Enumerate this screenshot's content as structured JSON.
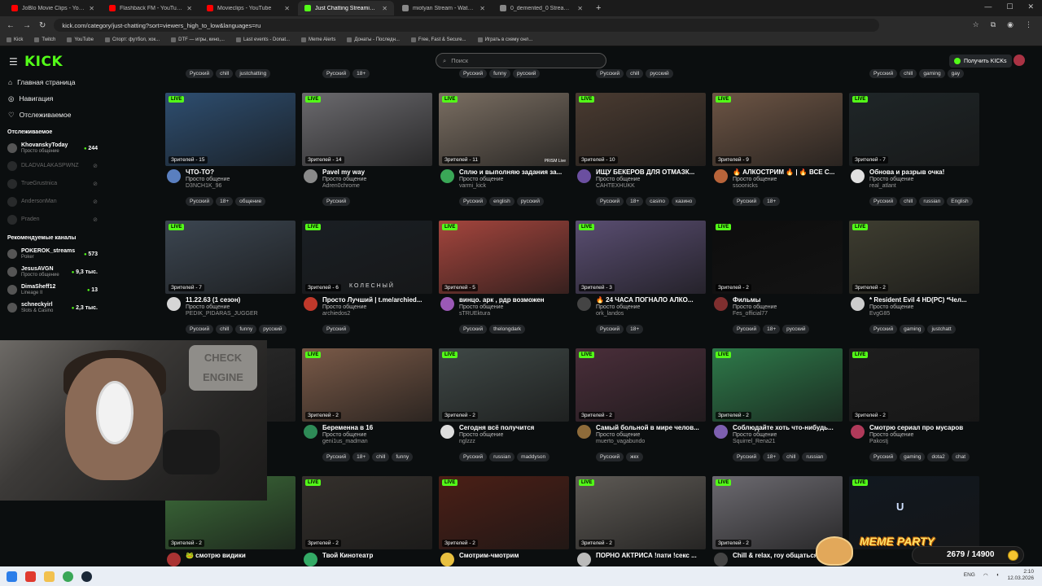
{
  "browser": {
    "tabs": [
      {
        "title": "JoBlo Movie Clips - YouTube",
        "color": "#ff0000",
        "active": false
      },
      {
        "title": "Flashback FM - YouTube",
        "color": "#ff0000",
        "active": false
      },
      {
        "title": "Movieclips - YouTube",
        "color": "#ff0000",
        "active": false
      },
      {
        "title": "Just Chatting Streaming - Live",
        "color": "#53fc18",
        "active": true
      },
      {
        "title": "miotyan Stream - Watch Live o",
        "color": "#888888",
        "active": false
      },
      {
        "title": "0_demented_0 Stream - Watch",
        "color": "#888888",
        "active": false
      }
    ],
    "url": "kick.com/category/just-chatting?sort=viewers_high_to_low&languages=ru",
    "bookmarks": [
      "Kick",
      "Twitch",
      "YouTube",
      "Спорт: футбол, хок...",
      "DTF — игры, кино,...",
      "Last events - Donat...",
      "Meme Alerts",
      "Донаты - Последн...",
      "Free, Fast & Secure...",
      "Играть в схему онл..."
    ]
  },
  "header": {
    "logo": "KICK",
    "search_placeholder": "Поиск",
    "get_kicks": "Получить KICKs"
  },
  "sidebar": {
    "nav": [
      {
        "label": "Главная страница",
        "icon": "home-icon"
      },
      {
        "label": "Навигация",
        "icon": "compass-icon"
      },
      {
        "label": "Отслеживаемое",
        "icon": "heart-icon"
      }
    ],
    "following_title": "Отслеживаемое",
    "following": [
      {
        "name": "KhovanskyToday",
        "category": "Просто общение",
        "count": "244",
        "online": true
      },
      {
        "name": "DLADVALAKASPWNZ",
        "category": "",
        "count": "",
        "online": false
      },
      {
        "name": "TrueGrustnica",
        "category": "",
        "count": "",
        "online": false
      },
      {
        "name": "AndersonMan",
        "category": "",
        "count": "",
        "online": false
      },
      {
        "name": "Praden",
        "category": "",
        "count": "",
        "online": false
      }
    ],
    "recommended_title": "Рекомендуемые каналы",
    "recommended": [
      {
        "name": "POKEROK_streams",
        "category": "Poker",
        "count": "573"
      },
      {
        "name": "JesusAVGN",
        "category": "Просто общение",
        "count": "9,3 тыс."
      },
      {
        "name": "DimaSheff12",
        "category": "Lineage II",
        "count": "13"
      },
      {
        "name": "schneckyirl",
        "category": "Slots & Casino",
        "count": "2,3 тыс."
      }
    ]
  },
  "top_tags_row": [
    [
      "Русский",
      "chill",
      "justchatting"
    ],
    [
      "Русский",
      "18+"
    ],
    [
      "Русский",
      "funny",
      "русский"
    ],
    [
      "Русский",
      "chill",
      "русский"
    ],
    [
      "Русский",
      "chill",
      "gaming",
      "gay"
    ]
  ],
  "cards": [
    {
      "title": "ЧТО-ТО?",
      "category": "Просто общение",
      "user": "D3NCH1K_96",
      "viewers": "Зрителей - 15",
      "tags": [
        "Русский",
        "18+",
        "общение"
      ],
      "bg": "#2e4e70"
    },
    {
      "title": "Pavel my way",
      "category": "Просто общение",
      "user": "Adren0chrome",
      "viewers": "Зрителей - 14",
      "tags": [
        "Русский"
      ],
      "bg": "#6b6a6e"
    },
    {
      "title": "Сплю и выполняю задания за...",
      "category": "Просто общение",
      "user": "varmi_kick",
      "viewers": "Зрителей - 11",
      "tags": [
        "Русский",
        "english",
        "русский"
      ],
      "bg": "#7a6e62"
    },
    {
      "title": "ИЩУ БЕКЕРОВ ДЛЯ ОТМАЗК...",
      "category": "Просто общение",
      "user": "CAHTEXHUKK",
      "viewers": "Зрителей - 10",
      "tags": [
        "Русский",
        "18+",
        "casino",
        "казино"
      ],
      "bg": "#4a3b31"
    },
    {
      "title": "🔥 АЛКОСТРИМ 🔥 | 🔥 ВСЕ С...",
      "category": "Просто общение",
      "user": "ssoonicks",
      "viewers": "Зрителей - 9",
      "tags": [
        "Русский",
        "18+"
      ],
      "bg": "#6d5545"
    },
    {
      "title": "Обнова и разрыв очка!",
      "category": "Просто общение",
      "user": "real_atlant",
      "viewers": "Зрителей - 7",
      "tags": [
        "Русский",
        "chill",
        "russian",
        "English"
      ],
      "bg": "#1f2628"
    },
    {
      "title": "11.22.63 (1 сезон)",
      "category": "Просто общение",
      "user": "PEDIK_PIDARAS_JUGGER",
      "viewers": "Зрителей - 7",
      "tags": [
        "Русский",
        "chill",
        "funny",
        "русский"
      ],
      "bg": "#3c4651"
    },
    {
      "title": "Просто Лучший | t.me/archied...",
      "category": "Просто общение",
      "user": "archiedos2",
      "viewers": "Зрителей - 6",
      "tags": [
        "Русский"
      ],
      "bg": "#1a1f24"
    },
    {
      "title": "винцо. арк , рдр возможен",
      "category": "Просто общение",
      "user": "sTRUEktura",
      "viewers": "Зрителей - 5",
      "tags": [
        "Русский",
        "thelongdark"
      ],
      "bg": "#a4453d"
    },
    {
      "title": "🔥 24 ЧАСА ПОГНАЛО АЛКО...",
      "category": "Просто общение",
      "user": "ork_landos",
      "viewers": "Зрителей - 3",
      "tags": [
        "Русский",
        "18+"
      ],
      "bg": "#5a4e72"
    },
    {
      "title": "Фильмы",
      "category": "Просто общение",
      "user": "Fes_official77",
      "viewers": "Зрителей - 2",
      "tags": [
        "Русский",
        "18+",
        "русский"
      ],
      "bg": "#0d0d0d"
    },
    {
      "title": "* Resident Evil 4 HD(PC) *Чел...",
      "category": "Просто общение",
      "user": "EvgG85",
      "viewers": "Зрителей - 2",
      "tags": [
        "Русский",
        "gaming",
        "justchatt"
      ],
      "bg": "#3e3d30"
    },
    {
      "title": "",
      "category": "",
      "user": "",
      "viewers": "",
      "tags": [],
      "bg": "#2c2c2c"
    },
    {
      "title": "Беременна в 16",
      "category": "Просто общение",
      "user": "geni1us_madman",
      "viewers": "Зрителей - 2",
      "tags": [
        "Русский",
        "18+",
        "chill",
        "funny"
      ],
      "bg": "#7a5a48"
    },
    {
      "title": "Сегодня всё получится",
      "category": "Просто общение",
      "user": "nglzzz",
      "viewers": "Зрителей - 2",
      "tags": [
        "Русский",
        "russian",
        "maddyson"
      ],
      "bg": "#3f4846"
    },
    {
      "title": "Самый больной в мире челов...",
      "category": "Просто общение",
      "user": "muerto_vagabundo",
      "viewers": "Зрителей - 2",
      "tags": [
        "Русский",
        "жкх"
      ],
      "bg": "#4a2e3a"
    },
    {
      "title": "Соблюдайте хоть что-нибудь...",
      "category": "Просто общение",
      "user": "Squirrel_Rena21",
      "viewers": "Зрителей - 2",
      "tags": [
        "Русский",
        "18+",
        "chill",
        "russian"
      ],
      "bg": "#2e7a4a"
    },
    {
      "title": "Смотрю сериал про мусаров",
      "category": "Просто общение",
      "user": "Pakostj",
      "viewers": "Зрителей - 2",
      "tags": [
        "Русский",
        "gaming",
        "dota2",
        "chat"
      ],
      "bg": "#1e1e1e"
    },
    {
      "title": "🐸 смотрю видики",
      "category": "",
      "user": "",
      "viewers": "Зрителей - 2",
      "tags": [],
      "bg": "#3d6d3a"
    },
    {
      "title": "Твой Кинотеатр",
      "category": "",
      "user": "",
      "viewers": "Зрителей - 2",
      "tags": [],
      "bg": "#34302c"
    },
    {
      "title": "Смотрим-чмотрим",
      "category": "",
      "user": "",
      "viewers": "Зрителей - 2",
      "tags": [],
      "bg": "#4b1f16"
    },
    {
      "title": "ПОРНО АКТРИСА !пати !секс ...",
      "category": "",
      "user": "",
      "viewers": "Зрителей - 2",
      "tags": [],
      "bg": "#5e5a55"
    },
    {
      "title": "Chill & relax, roy общаться...",
      "category": "",
      "user": "",
      "viewers": "Зрителей - 2",
      "tags": [],
      "bg": "#6c6a70"
    },
    {
      "title": "",
      "category": "",
      "user": "",
      "viewers": "",
      "tags": [],
      "bg": "#111820"
    }
  ],
  "card_overlay_text": {
    "u_label": "U",
    "kolesny": "КОЛЕСНЫЙ",
    "prism": "PRISM Live"
  },
  "webcam": {
    "sign_text": "CHECK ENGINE"
  },
  "meme_party": {
    "label": "MEME PARTY",
    "count": "2679 / 14900"
  },
  "taskbar": {
    "lang": "ENG",
    "time": "2:10",
    "date": "12.03.2026"
  }
}
